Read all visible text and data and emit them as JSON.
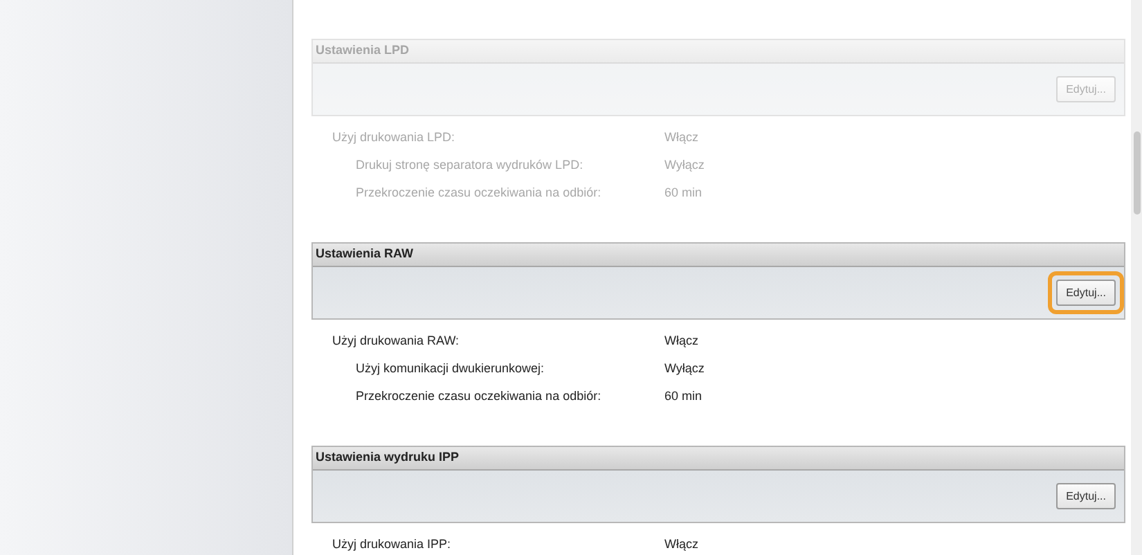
{
  "sections": [
    {
      "title": "Ustawienia LPD",
      "dimmed": true,
      "edit_button": {
        "label": "Edytuj...",
        "highlighted": false
      },
      "settings": [
        {
          "label": "Użyj drukowania LPD:",
          "value": "Włącz",
          "children": [
            {
              "label": "Drukuj stronę separatora wydruków LPD:",
              "value": "Wyłącz"
            },
            {
              "label": "Przekroczenie czasu oczekiwania na odbiór:",
              "value": "60 min"
            }
          ]
        }
      ]
    },
    {
      "title": "Ustawienia RAW",
      "dimmed": false,
      "edit_button": {
        "label": "Edytuj...",
        "highlighted": true
      },
      "settings": [
        {
          "label": "Użyj drukowania RAW:",
          "value": "Włącz",
          "children": [
            {
              "label": "Użyj komunikacji dwukierunkowej:",
              "value": "Wyłącz"
            },
            {
              "label": "Przekroczenie czasu oczekiwania na odbiór:",
              "value": "60 min"
            }
          ]
        }
      ]
    },
    {
      "title": "Ustawienia wydruku IPP",
      "dimmed": false,
      "edit_button": {
        "label": "Edytuj...",
        "highlighted": false
      },
      "settings": [
        {
          "label": "Użyj drukowania IPP:",
          "value": "Włącz"
        }
      ]
    }
  ]
}
